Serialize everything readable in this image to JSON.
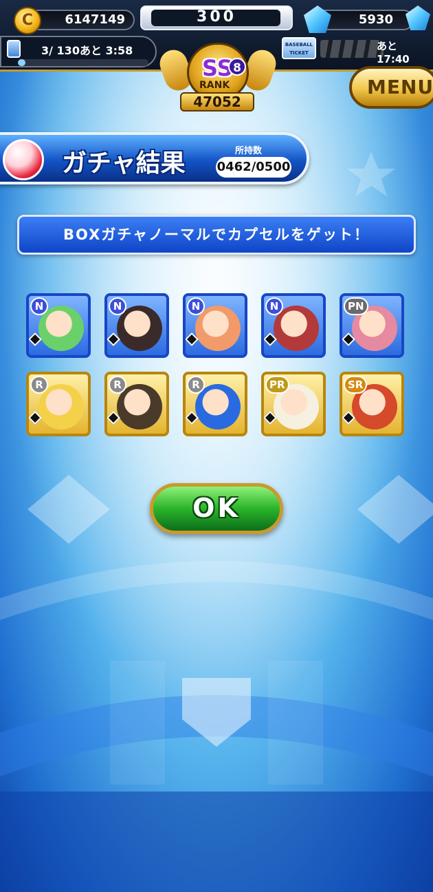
{
  "hud": {
    "coins": "6147149",
    "center_value": "300",
    "gems": "5930",
    "stamina": "3/ 130あと 3:58",
    "ticket_label_top": "BASEBALL",
    "ticket_label_bottom": "TICKET",
    "ticket_timer": "あと 17:40",
    "rank_grade": "SS",
    "rank_level": "8",
    "rank_label": "RANK",
    "rank_points": "47052",
    "menu_label": "MENU"
  },
  "title": {
    "text": "ガチャ結果",
    "owned_label": "所持数",
    "owned_value": "0462/0500"
  },
  "message": "BOXガチャノーマルでカプセルをゲット！",
  "cards": [
    {
      "rarity": "N",
      "frame": "blue",
      "face": "#6ad16a"
    },
    {
      "rarity": "N",
      "frame": "blue",
      "face": "#3a2a2a"
    },
    {
      "rarity": "N",
      "frame": "blue",
      "face": "#f29a6a"
    },
    {
      "rarity": "N",
      "frame": "blue",
      "face": "#b33a3a"
    },
    {
      "rarity": "PN",
      "frame": "blue",
      "face": "#e58aa0"
    },
    {
      "rarity": "R",
      "frame": "gold",
      "face": "#f3d24a"
    },
    {
      "rarity": "R",
      "frame": "gold",
      "face": "#4a3a2a"
    },
    {
      "rarity": "R",
      "frame": "gold",
      "face": "#2a6ae0"
    },
    {
      "rarity": "PR",
      "frame": "gold",
      "face": "#f5f0e0"
    },
    {
      "rarity": "SR",
      "frame": "gold",
      "face": "#d44a2a"
    }
  ],
  "ok_label": "OK",
  "colors": {
    "accent_gold": "#c79a2b",
    "title_blue": "#1354c6",
    "ok_green": "#2ab42a"
  }
}
